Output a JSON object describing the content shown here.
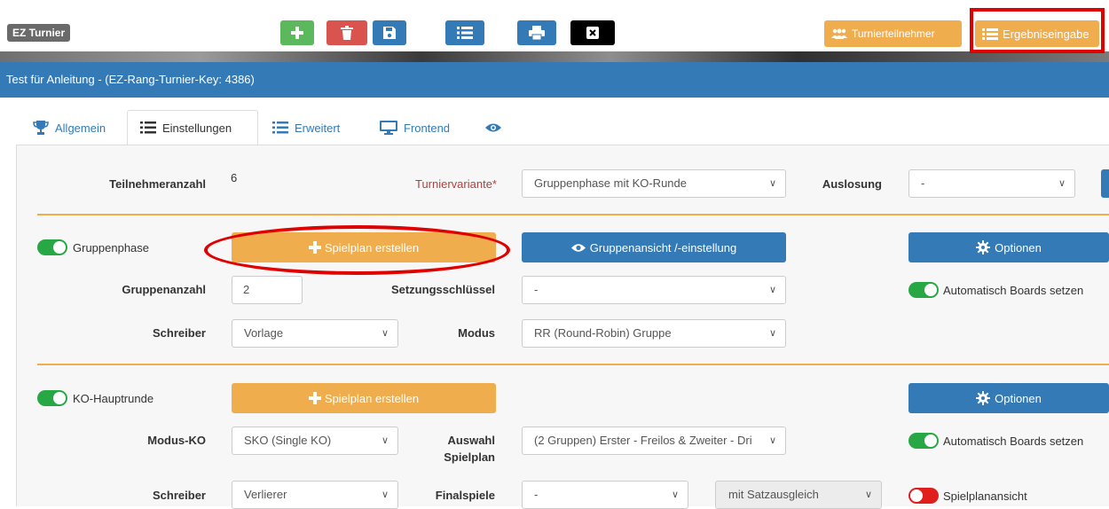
{
  "header": {
    "brand": "EZ Turnier",
    "toolbar": {
      "add_icon": "plus-icon",
      "delete_icon": "trash-icon",
      "save_icon": "save-icon",
      "list_icon": "list-icon",
      "print_icon": "print-icon",
      "close_icon": "close-icon"
    },
    "participants_label": "Turnierteilnehmer",
    "results_label": "Ergebniseingabe"
  },
  "title": "Test für Anleitung - (EZ-Rang-Turnier-Key: 4386)",
  "tabs": [
    {
      "label": "Allgemein",
      "icon": "trophy-icon"
    },
    {
      "label": "Einstellungen",
      "icon": "list-icon",
      "active": true
    },
    {
      "label": "Erweitert",
      "icon": "list-icon"
    },
    {
      "label": "Frontend",
      "icon": "monitor-icon"
    },
    {
      "label": "",
      "icon": "eye-icon"
    }
  ],
  "settings": {
    "teilnehmer_label": "Teilnehmeranzahl",
    "teilnehmer_value": "6",
    "variante_label": "Turniervariante*",
    "variante_value": "Gruppenphase mit KO-Runde",
    "auslosung_label": "Auslosung",
    "auslosung_value": "-"
  },
  "gruppenphase": {
    "toggle_label": "Gruppenphase",
    "toggle_on": true,
    "spielplan_button": "Spielplan erstellen",
    "ansicht_button": "Gruppenansicht /-einstellung",
    "optionen_button": "Optionen",
    "gruppenanzahl_label": "Gruppenanzahl",
    "gruppenanzahl_value": "2",
    "setzung_label": "Setzungsschlüssel",
    "setzung_value": "-",
    "auto_boards_label": "Automatisch Boards setzen",
    "schreiber_label": "Schreiber",
    "schreiber_value": "Vorlage",
    "modus_label": "Modus",
    "modus_value": "RR (Round-Robin) Gruppe"
  },
  "ko": {
    "toggle_label": "KO-Hauptrunde",
    "toggle_on": true,
    "spielplan_button": "Spielplan erstellen",
    "optionen_button": "Optionen",
    "modus_label": "Modus-KO",
    "modus_value": "SKO (Single KO)",
    "auswahl_label_1": "Auswahl",
    "auswahl_label_2": "Spielplan",
    "auswahl_value": "(2 Gruppen) Erster - Freilos & Zweiter - Dri",
    "auto_boards_label": "Automatisch Boards setzen",
    "schreiber_label": "Schreiber",
    "schreiber_value": "Verlierer",
    "finalspiele_label": "Finalspiele",
    "finalspiele_value": "-",
    "satzausgleich_value": "mit Satzausgleich",
    "spielplanansicht_label": "Spielplanansicht",
    "spielplanansicht_on": false
  },
  "colors": {
    "primary": "#337ab7",
    "warning": "#f0ad4e",
    "success": "#5cb85c",
    "danger": "#d9534f",
    "highlight": "#e00000"
  }
}
